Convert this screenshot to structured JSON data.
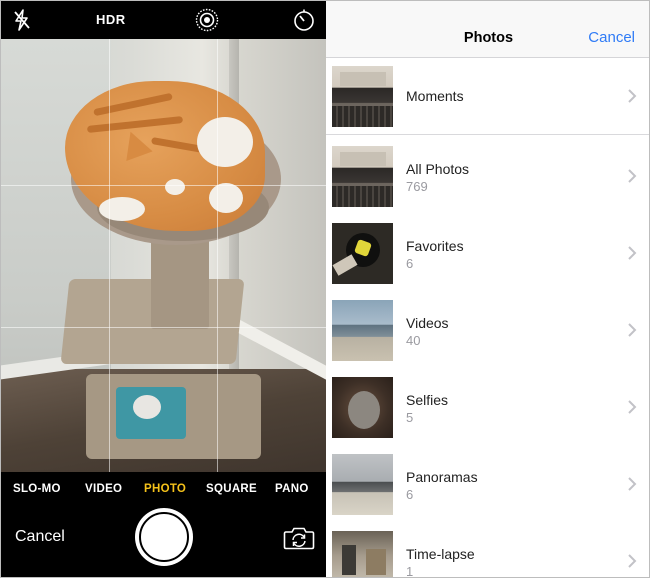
{
  "camera": {
    "top_bar": {
      "flash_icon": "flash-off-icon",
      "hdr_label": "HDR",
      "live_icon": "live-photo-icon",
      "timer_icon": "timer-icon"
    },
    "modes": [
      {
        "label": "SLO-MO",
        "active": false
      },
      {
        "label": "VIDEO",
        "active": false
      },
      {
        "label": "PHOTO",
        "active": true
      },
      {
        "label": "SQUARE",
        "active": false
      },
      {
        "label": "PANO",
        "active": false
      }
    ],
    "active_mode_color": "#f5c21a",
    "cancel_label": "Cancel",
    "shutter_icon": "shutter-button-icon",
    "flip_icon": "camera-flip-icon"
  },
  "photos": {
    "title": "Photos",
    "cancel_label": "Cancel",
    "accent_color": "#2f7bf6",
    "albums": [
      {
        "label": "Moments",
        "count": null,
        "thumb": "laptop"
      },
      {
        "label": "All Photos",
        "count": "769",
        "thumb": "laptop"
      },
      {
        "label": "Favorites",
        "count": "6",
        "thumb": "fav"
      },
      {
        "label": "Videos",
        "count": "40",
        "thumb": "beach"
      },
      {
        "label": "Selfies",
        "count": "5",
        "thumb": "selfie"
      },
      {
        "label": "Panoramas",
        "count": "6",
        "thumb": "pano"
      },
      {
        "label": "Time-lapse",
        "count": "1",
        "thumb": "tl"
      }
    ]
  }
}
